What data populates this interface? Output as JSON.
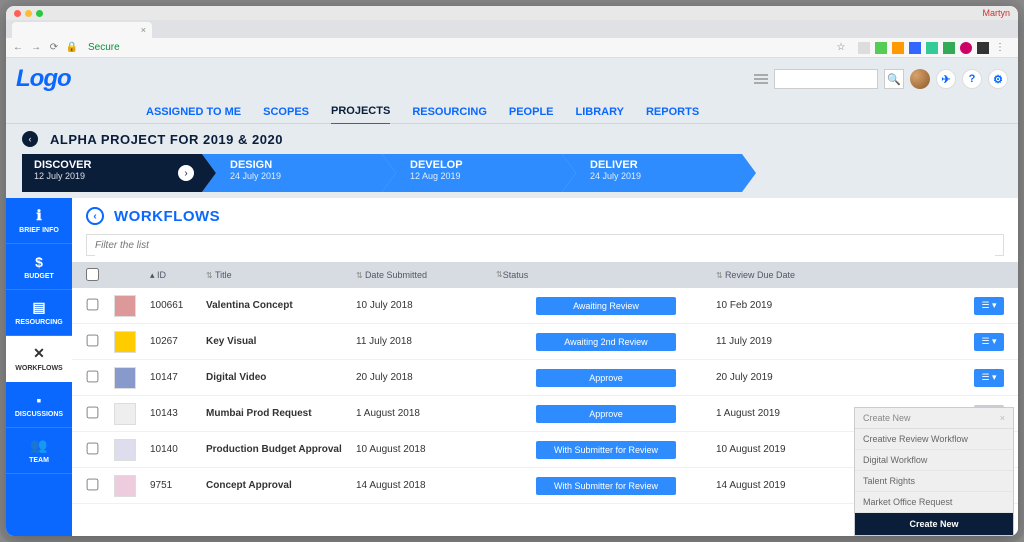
{
  "os": {
    "user": "Martyn"
  },
  "browser": {
    "secure_label": "Secure"
  },
  "header": {
    "logo": "Logo",
    "nav": [
      "ASSIGNED TO ME",
      "SCOPES",
      "PROJECTS",
      "RESOURCING",
      "PEOPLE",
      "LIBRARY",
      "REPORTS"
    ],
    "active_nav": 2
  },
  "breadcrumb": {
    "title": "ALPHA PROJECT FOR 2019 & 2020"
  },
  "phases": [
    {
      "name": "DISCOVER",
      "date": "12 July 2019",
      "tone": "dark",
      "go": true
    },
    {
      "name": "DESIGN",
      "date": "24 July 2019",
      "tone": "light"
    },
    {
      "name": "DEVELOP",
      "date": "12 Aug 2019",
      "tone": "light"
    },
    {
      "name": "DELIVER",
      "date": "24 July 2019",
      "tone": "light"
    }
  ],
  "sidebar": [
    {
      "label": "BRIEF INFO",
      "icon": "ℹ"
    },
    {
      "label": "BUDGET",
      "icon": "$"
    },
    {
      "label": "RESOURCING",
      "icon": "▤"
    },
    {
      "label": "WORKFLOWS",
      "icon": "✕"
    },
    {
      "label": "DISCUSSIONS",
      "icon": "▪"
    },
    {
      "label": "TEAM",
      "icon": "👥"
    }
  ],
  "sidebar_active": 3,
  "section": {
    "title": "WORKFLOWS",
    "filter_placeholder": "Filter the list"
  },
  "columns": {
    "id": "ID",
    "title": "Title",
    "date": "Date Submitted",
    "status": "Status",
    "review": "Review Due Date"
  },
  "rows": [
    {
      "id": "100661",
      "title": "Valentina Concept",
      "date": "10 July 2018",
      "status": "Awaiting Review",
      "review": "10 Feb 2019",
      "act": "blue"
    },
    {
      "id": "10267",
      "title": "Key Visual",
      "date": "11 July 2018",
      "status": "Awaiting 2nd Review",
      "review": "11 July 2019",
      "act": "blue"
    },
    {
      "id": "10147",
      "title": "Digital Video",
      "date": "20 July 2018",
      "status": "Approve",
      "review": "20 July 2019",
      "act": "blue"
    },
    {
      "id": "10143",
      "title": "Mumbai Prod Request",
      "date": "1 August 2018",
      "status": "Approve",
      "review": "1 August 2019",
      "act": "muted"
    },
    {
      "id": "10140",
      "title": "Production Budget Approval",
      "date": "10 August 2018",
      "status": "With Submitter for Review",
      "review": "10 August 2019",
      "act": "muted"
    },
    {
      "id": "9751",
      "title": "Concept Approval",
      "date": "14 August 2018",
      "status": "With Submitter for Review",
      "review": "14 August 2019",
      "act": "muted"
    }
  ],
  "dropdown": {
    "header": "Create New",
    "items": [
      "Creative Review Workflow",
      "Digital Workflow",
      "Talent Rights",
      "Market Office Request"
    ],
    "footer": "Create New"
  }
}
